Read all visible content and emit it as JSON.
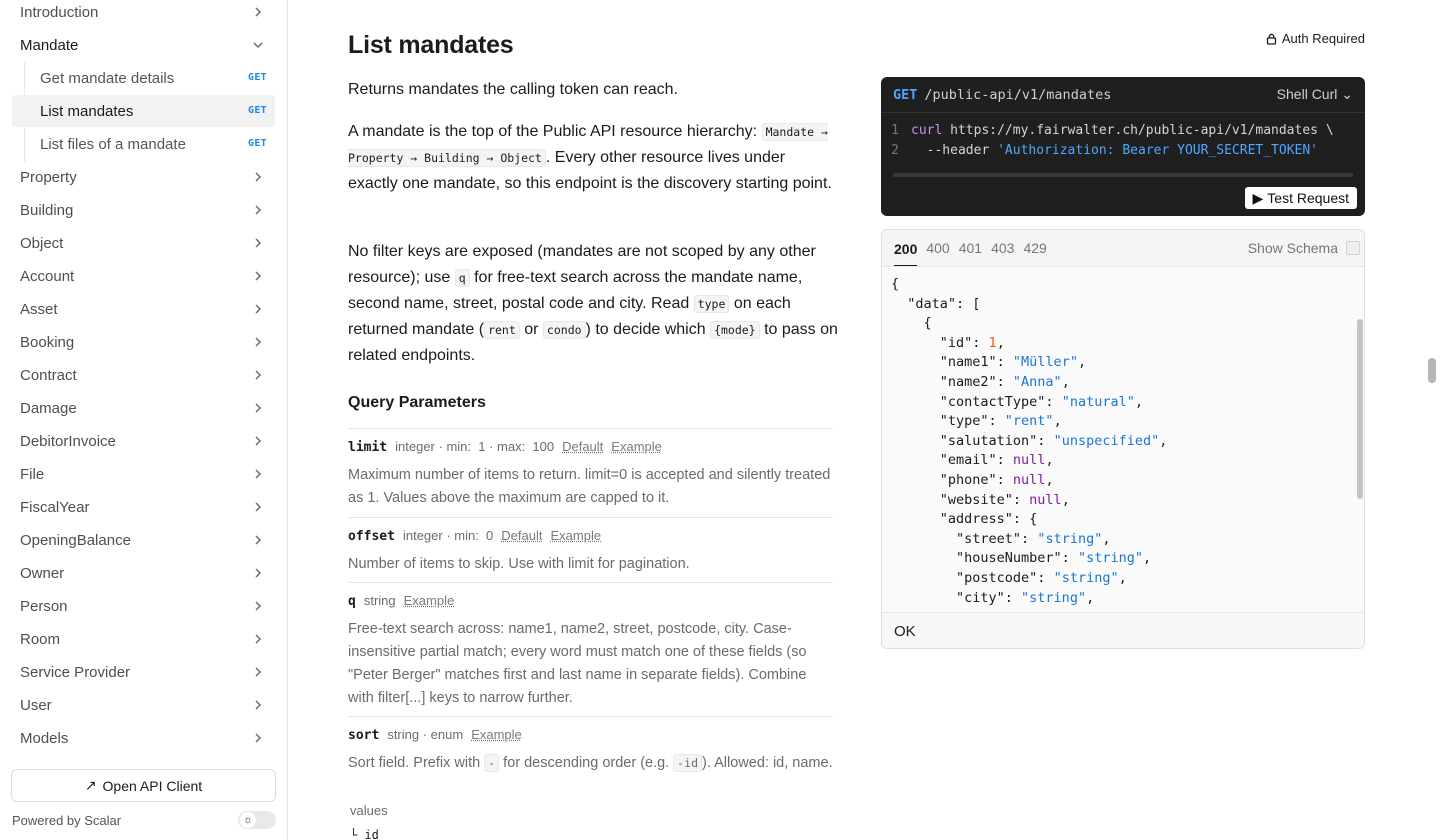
{
  "sidebar": {
    "nav_top": [
      {
        "label": "Introduction"
      },
      {
        "label": "Mandate"
      }
    ],
    "mandate_sub": [
      {
        "label": "Get mandate details",
        "method": "GET"
      },
      {
        "label": "List mandates",
        "method": "GET"
      },
      {
        "label": "List files of a mandate",
        "method": "GET"
      }
    ],
    "nav_rest": [
      {
        "label": "Property"
      },
      {
        "label": "Building"
      },
      {
        "label": "Object"
      },
      {
        "label": "Account"
      },
      {
        "label": "Asset"
      },
      {
        "label": "Booking"
      },
      {
        "label": "Contract"
      },
      {
        "label": "Damage"
      },
      {
        "label": "DebitorInvoice"
      },
      {
        "label": "File"
      },
      {
        "label": "FiscalYear"
      },
      {
        "label": "OpeningBalance"
      },
      {
        "label": "Owner"
      },
      {
        "label": "Person"
      },
      {
        "label": "Room"
      },
      {
        "label": "Service Provider"
      },
      {
        "label": "User"
      },
      {
        "label": "Models"
      }
    ],
    "open_api_client": "Open API Client",
    "powered_by": "Powered by Scalar"
  },
  "main": {
    "title": "List mandates",
    "auth": "Auth Required",
    "p1": "Returns mandates the calling token can reach.",
    "p2a": "A mandate is the top of the Public API resource hierarchy:",
    "p2code": "Mandate → Property → Building → Object",
    "p2b": ". Every other resource lives under exactly one mandate, so this endpoint is the discovery starting point.",
    "p3a": "No filter keys are exposed (mandates are not scoped by any other resource); use",
    "p3code1": "q",
    "p3b": "for free-text search across the mandate name, second name, street, postal code and city. Read",
    "p3code2": "type",
    "p3c": "on each returned mandate (",
    "p3code3": "rent",
    "p3d": "or",
    "p3code4": "condo",
    "p3e": ") to decide which",
    "p3code5": "{mode}",
    "p3f": "to pass on related endpoints.",
    "query_title": "Query Parameters",
    "params": [
      {
        "name": "limit",
        "meta": "integer · min:  1 · max:  100",
        "links": [
          "Default",
          "Example"
        ],
        "desc": "Maximum number of items to return. limit=0 is accepted and silently treated as 1. Values above the maximum are capped to it."
      },
      {
        "name": "offset",
        "meta": "integer · min:  0",
        "links": [
          "Default",
          "Example"
        ],
        "desc": "Number of items to skip. Use with limit for pagination."
      },
      {
        "name": "q",
        "meta": "string",
        "links": [
          "Example"
        ],
        "desc": "Free-text search across: name1, name2, street, postcode, city. Case-insensitive partial match; every word must match one of these fields (so \"Peter Berger\" matches first and last name in separate fields). Combine with filter[...] keys to narrow further."
      },
      {
        "name": "sort",
        "meta": "string · enum",
        "links": [
          "Example"
        ],
        "desc_a": "Sort field. Prefix with",
        "desc_code1": "-",
        "desc_b": "for descending order (e.g.",
        "desc_code2": "-id",
        "desc_c": "). Allowed: id, name."
      }
    ],
    "values_label": "values",
    "values_first": "id"
  },
  "request": {
    "method": "GET",
    "path": "/public-api/v1/mandates",
    "lang": "Shell Curl",
    "line1_cmd": "curl",
    "line1_url": "https://my.fairwalter.ch/public-api/v1/mandates \\",
    "line2_flag": "--header",
    "line2_val": "'Authorization: Bearer YOUR_SECRET_TOKEN'",
    "test_button": "Test Request"
  },
  "response": {
    "tabs": [
      "200",
      "400",
      "401",
      "403",
      "429"
    ],
    "show_schema": "Show Schema",
    "footer": "OK",
    "json": {
      "id": "1",
      "name1": "\"Müller\"",
      "name2": "\"Anna\"",
      "contactType": "\"natural\"",
      "type": "\"rent\"",
      "salutation": "\"unspecified\"",
      "email": "null",
      "phone": "null",
      "website": "null",
      "street": "\"string\"",
      "houseNumber": "\"string\"",
      "postcode": "\"string\"",
      "city": "\"string\""
    }
  }
}
